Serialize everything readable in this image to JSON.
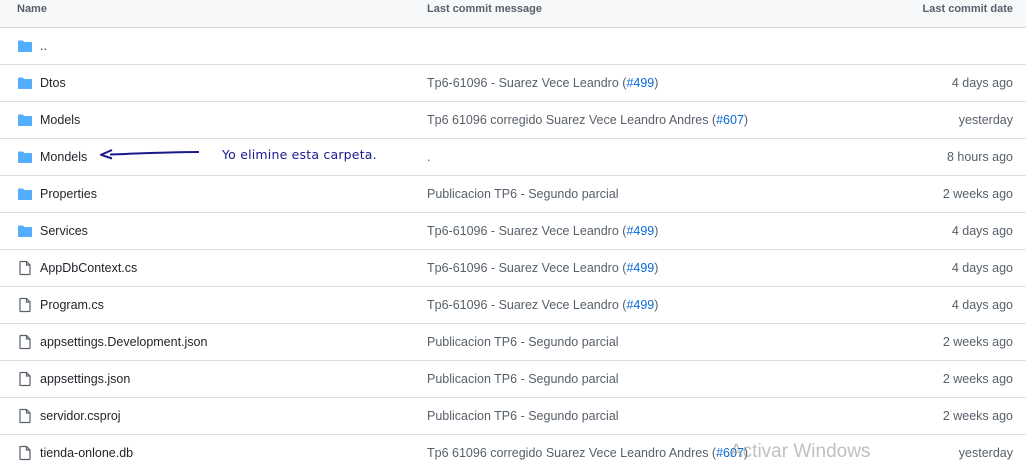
{
  "columns": {
    "name": "Name",
    "message": "Last commit message",
    "date": "Last commit date"
  },
  "parent_link": "..",
  "rows": [
    {
      "type": "folder",
      "name": "Dtos",
      "message": "Tp6-61096 - Suarez Vece Leandro (",
      "pr": "#499",
      "message_end": ")",
      "date": "4 days ago"
    },
    {
      "type": "folder",
      "name": "Models",
      "message": "Tp6 61096 corregido Suarez Vece Leandro Andres (",
      "pr": "#607",
      "message_end": ")",
      "date": "yesterday"
    },
    {
      "type": "folder",
      "name": "Mondels",
      "message": ".",
      "pr": "",
      "message_end": "",
      "date": "8 hours ago"
    },
    {
      "type": "folder",
      "name": "Properties",
      "message": "Publicacion TP6 - Segundo parcial",
      "pr": "",
      "message_end": "",
      "date": "2 weeks ago"
    },
    {
      "type": "folder",
      "name": "Services",
      "message": "Tp6-61096 - Suarez Vece Leandro (",
      "pr": "#499",
      "message_end": ")",
      "date": "4 days ago"
    },
    {
      "type": "file",
      "name": "AppDbContext.cs",
      "message": "Tp6-61096 - Suarez Vece Leandro (",
      "pr": "#499",
      "message_end": ")",
      "date": "4 days ago"
    },
    {
      "type": "file",
      "name": "Program.cs",
      "message": "Tp6-61096 - Suarez Vece Leandro (",
      "pr": "#499",
      "message_end": ")",
      "date": "4 days ago"
    },
    {
      "type": "file",
      "name": "appsettings.Development.json",
      "message": "Publicacion TP6 - Segundo parcial",
      "pr": "",
      "message_end": "",
      "date": "2 weeks ago"
    },
    {
      "type": "file",
      "name": "appsettings.json",
      "message": "Publicacion TP6 - Segundo parcial",
      "pr": "",
      "message_end": "",
      "date": "2 weeks ago"
    },
    {
      "type": "file",
      "name": "servidor.csproj",
      "message": "Publicacion TP6 - Segundo parcial",
      "pr": "",
      "message_end": "",
      "date": "2 weeks ago"
    },
    {
      "type": "file",
      "name": "tienda-onlone.db",
      "message": "Tp6 61096 corregido Suarez Vece Leandro Andres (",
      "pr": "#607",
      "message_end": ")",
      "date": "yesterday"
    }
  ],
  "annotation": "Yo elimine esta carpeta.",
  "watermark": "Activar Windows",
  "colors": {
    "folder": "#54aeff",
    "link": "#0969da",
    "annotation": "#1a1a8c"
  }
}
